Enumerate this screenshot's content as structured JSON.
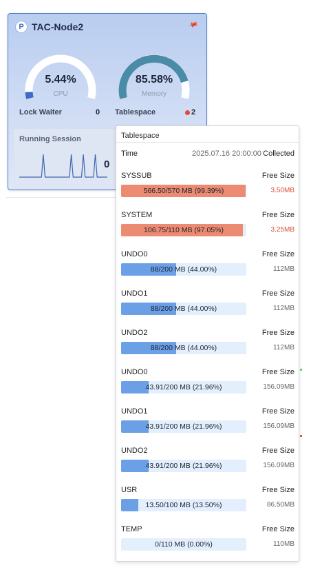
{
  "node": {
    "badge": "P",
    "title": "TAC-Node2",
    "cpu": {
      "value": "5.44%",
      "label": "CPU",
      "fraction": 0.0544,
      "color": "#3e6cc5"
    },
    "memory": {
      "value": "85.58%",
      "label": "Memory",
      "fraction": 0.8558,
      "color": "#4a8ba8"
    },
    "lock_waiter": {
      "label": "Lock Waiter",
      "value": "0"
    },
    "tablespace": {
      "label": "Tablespace",
      "value": "2",
      "alert_color": "#e04a3c"
    },
    "running_session": {
      "label": "Running Session",
      "value": "0",
      "spikes": [
        0,
        0,
        0,
        0,
        0,
        0,
        1,
        0,
        0,
        0,
        0,
        0,
        0,
        1,
        0,
        0,
        1,
        0,
        0,
        1,
        0,
        0,
        0
      ]
    }
  },
  "popup": {
    "title": "Tablespace",
    "time_label": "Time",
    "time_value": "2025.07.16 20:00:00",
    "time_col": "Collected",
    "rows": [
      {
        "name": "SYSSUB",
        "free_label": "Free Size",
        "bar_text": "566.50/570 MB (99.39%)",
        "pct": 99.39,
        "free": "3.50MB",
        "alert": true
      },
      {
        "name": "SYSTEM",
        "free_label": "Free Size",
        "bar_text": "106.75/110 MB (97.05%)",
        "pct": 97.05,
        "free": "3.25MB",
        "alert": true
      },
      {
        "name": "UNDO0",
        "free_label": "Free Size",
        "bar_text": "88/200 MB (44.00%)",
        "pct": 44.0,
        "free": "112MB",
        "alert": false
      },
      {
        "name": "UNDO1",
        "free_label": "Free Size",
        "bar_text": "88/200 MB (44.00%)",
        "pct": 44.0,
        "free": "112MB",
        "alert": false
      },
      {
        "name": "UNDO2",
        "free_label": "Free Size",
        "bar_text": "88/200 MB (44.00%)",
        "pct": 44.0,
        "free": "112MB",
        "alert": false
      },
      {
        "name": "UNDO0",
        "free_label": "Free Size",
        "bar_text": "43.91/200 MB (21.96%)",
        "pct": 21.96,
        "free": "156.09MB",
        "alert": false
      },
      {
        "name": "UNDO1",
        "free_label": "Free Size",
        "bar_text": "43.91/200 MB (21.96%)",
        "pct": 21.96,
        "free": "156.09MB",
        "alert": false
      },
      {
        "name": "UNDO2",
        "free_label": "Free Size",
        "bar_text": "43.91/200 MB (21.96%)",
        "pct": 21.96,
        "free": "156.09MB",
        "alert": false
      },
      {
        "name": "USR",
        "free_label": "Free Size",
        "bar_text": "13.50/100 MB (13.50%)",
        "pct": 13.5,
        "free": "86.50MB",
        "alert": false
      },
      {
        "name": "TEMP",
        "free_label": "Free Size",
        "bar_text": "0/110 MB (0.00%)",
        "pct": 0.0,
        "free": "110MB",
        "alert": false
      }
    ]
  },
  "colors": {
    "alert_fill": "#ec8a72",
    "normal_fill": "#6b9fe6",
    "bar_track": "#e3effd"
  }
}
